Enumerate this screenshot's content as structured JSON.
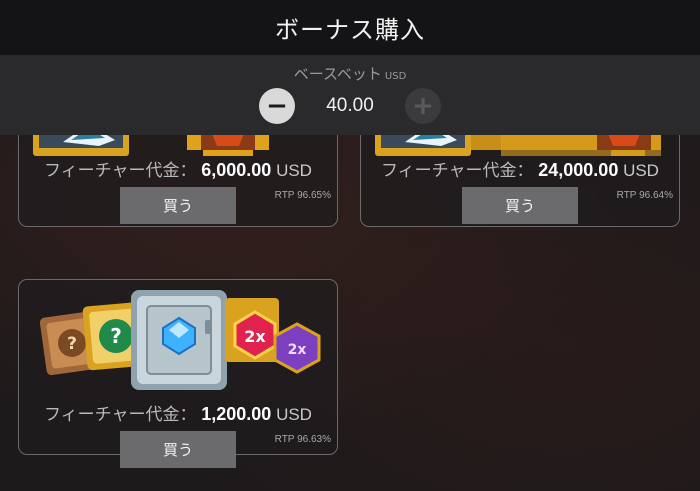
{
  "header": {
    "title": "ボーナス購入"
  },
  "bet": {
    "label": "ベースベット",
    "unit": "USD",
    "value": "40.00",
    "minus_label": "−",
    "plus_label": "+"
  },
  "cards": [
    {
      "price_label": "フィーチャー代金：",
      "amount": "6,000.00",
      "currency": "USD",
      "rtp": "RTP 96.65%",
      "buy_label": "買う"
    },
    {
      "price_label": "フィーチャー代金：",
      "amount": "24,000.00",
      "currency": "USD",
      "rtp": "RTP 96.64%",
      "buy_label": "買う"
    },
    {
      "price_label": "フィーチャー代金：",
      "amount": "1,200.00",
      "currency": "USD",
      "rtp": "RTP 96.63%",
      "buy_label": "買う"
    }
  ],
  "symbols": {
    "question": "?",
    "multiplier": "2x"
  },
  "colors": {
    "header_bg": "#141315",
    "panel_bg": "#2a2a2c",
    "buy_button": "#6b6b6d",
    "gold": "#d9a21f",
    "safe_silver": "#c9d6de",
    "gem_blue": "#3fb2ff",
    "gem_red": "#e0224f",
    "gem_purple": "#7b3fbf"
  }
}
